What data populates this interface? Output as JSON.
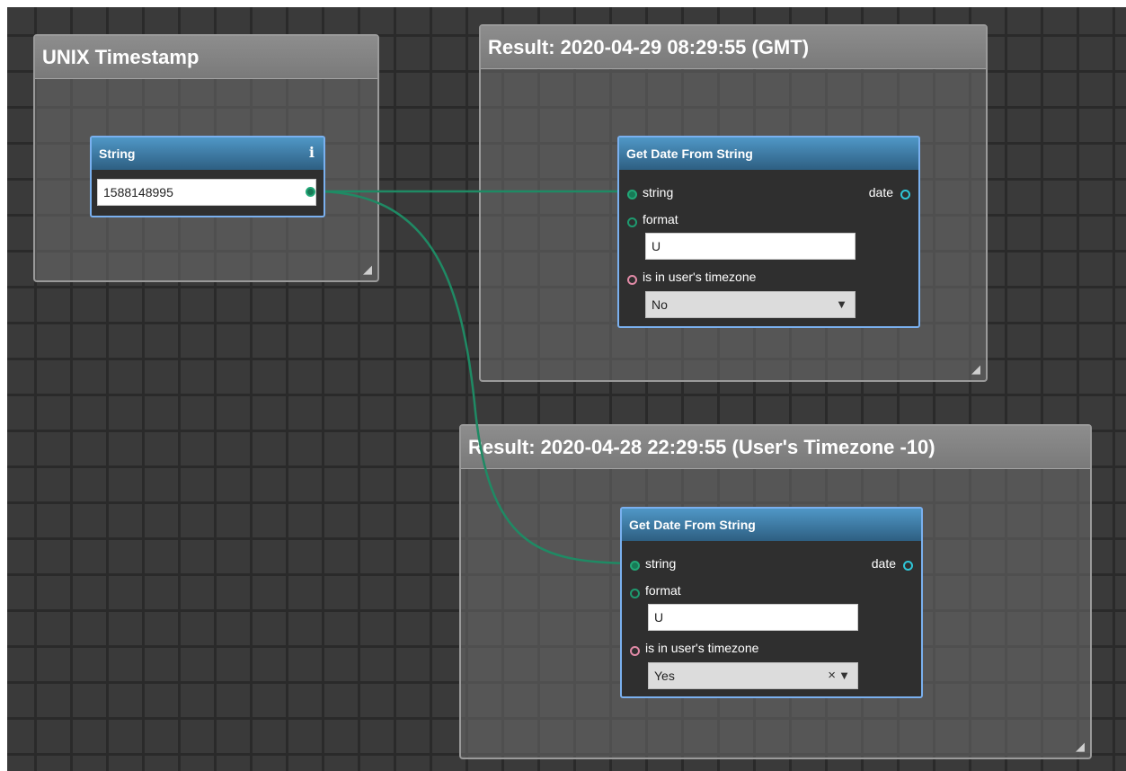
{
  "groups": {
    "unix": {
      "title": "UNIX Timestamp"
    },
    "gmt": {
      "title": "Result: 2020-04-29 08:29:55 (GMT)"
    },
    "user": {
      "title": "Result: 2020-04-28 22:29:55 (User's Timezone -10)"
    },
    "resize_glyph": "◢"
  },
  "string_node": {
    "title": "String",
    "info_icon": "i",
    "value": "1588148995"
  },
  "gmt_node": {
    "title": "Get Date From String",
    "input_string_label": "string",
    "output_date_label": "date",
    "format_label": "format",
    "format_value": "U",
    "timezone_label": "is in user's timezone",
    "timezone_value": "No",
    "dropdown_arrow": "▼"
  },
  "user_node": {
    "title": "Get Date From String",
    "input_string_label": "string",
    "output_date_label": "date",
    "format_label": "format",
    "format_value": "U",
    "timezone_label": "is in user's timezone",
    "timezone_value": "Yes",
    "clear_icon": "×",
    "dropdown_arrow": "▼"
  },
  "colors": {
    "canvas_bg": "#3a3a3a",
    "grid_line": "#2a2a2a",
    "node_border": "#7ab0ef",
    "node_header": "#3c7aa6",
    "wire": "#1f8a64",
    "port_pink": "#e08aa6",
    "port_cyan": "#2fc6d8"
  }
}
